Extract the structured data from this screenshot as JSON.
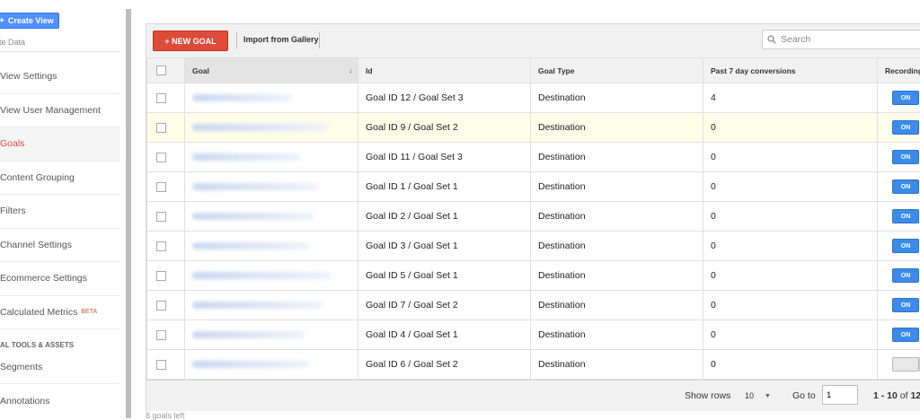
{
  "sidebar": {
    "create_view_label": "Create View",
    "view_data_label": "te Data",
    "items": [
      {
        "label": "View Settings"
      },
      {
        "label": "View User Management"
      },
      {
        "label": "Goals",
        "active": true
      },
      {
        "label": "Content Grouping"
      },
      {
        "label": "Filters"
      },
      {
        "label": "Channel Settings"
      },
      {
        "label": "Ecommerce Settings"
      },
      {
        "label": "Calculated Metrics",
        "badge": "BETA"
      }
    ],
    "section_label": "AL TOOLS & ASSETS",
    "tools": [
      {
        "label": "Segments"
      },
      {
        "label": "Annotations"
      }
    ]
  },
  "toolbar": {
    "new_goal_label": "+ NEW GOAL",
    "import_label": "Import from Gallery",
    "search_placeholder": "Search"
  },
  "table": {
    "columns": [
      "Goal",
      "Id",
      "Goal Type",
      "Past 7 day conversions",
      "Recording"
    ],
    "rows": [
      {
        "id": "Goal ID 12 / Goal Set 3",
        "type": "Destination",
        "conversions": "4",
        "recording": "ON"
      },
      {
        "id": "Goal ID 9 / Goal Set 2",
        "type": "Destination",
        "conversions": "0",
        "recording": "ON"
      },
      {
        "id": "Goal ID 11 / Goal Set 3",
        "type": "Destination",
        "conversions": "0",
        "recording": "ON"
      },
      {
        "id": "Goal ID 1 / Goal Set 1",
        "type": "Destination",
        "conversions": "0",
        "recording": "ON"
      },
      {
        "id": "Goal ID 2 / Goal Set 1",
        "type": "Destination",
        "conversions": "0",
        "recording": "ON"
      },
      {
        "id": "Goal ID 3 / Goal Set 1",
        "type": "Destination",
        "conversions": "0",
        "recording": "ON"
      },
      {
        "id": "Goal ID 5 / Goal Set 1",
        "type": "Destination",
        "conversions": "0",
        "recording": "ON"
      },
      {
        "id": "Goal ID 7 / Goal Set 2",
        "type": "Destination",
        "conversions": "0",
        "recording": "ON"
      },
      {
        "id": "Goal ID 4 / Goal Set 1",
        "type": "Destination",
        "conversions": "0",
        "recording": "ON"
      },
      {
        "id": "Goal ID 6 / Goal Set 2",
        "type": "Destination",
        "conversions": "0",
        "recording": "OFF"
      }
    ]
  },
  "pager": {
    "show_rows_label": "Show rows",
    "rows_value": "10",
    "goto_label": "Go to",
    "goto_value": "1",
    "range_label": "1 - 10",
    "of_label": "of",
    "total": "12"
  },
  "goals_left_label": "8 goals left",
  "colors": {
    "accent_red": "#dd4b39",
    "toggle_blue": "#3b8bea",
    "create_blue": "#4d90fe"
  }
}
